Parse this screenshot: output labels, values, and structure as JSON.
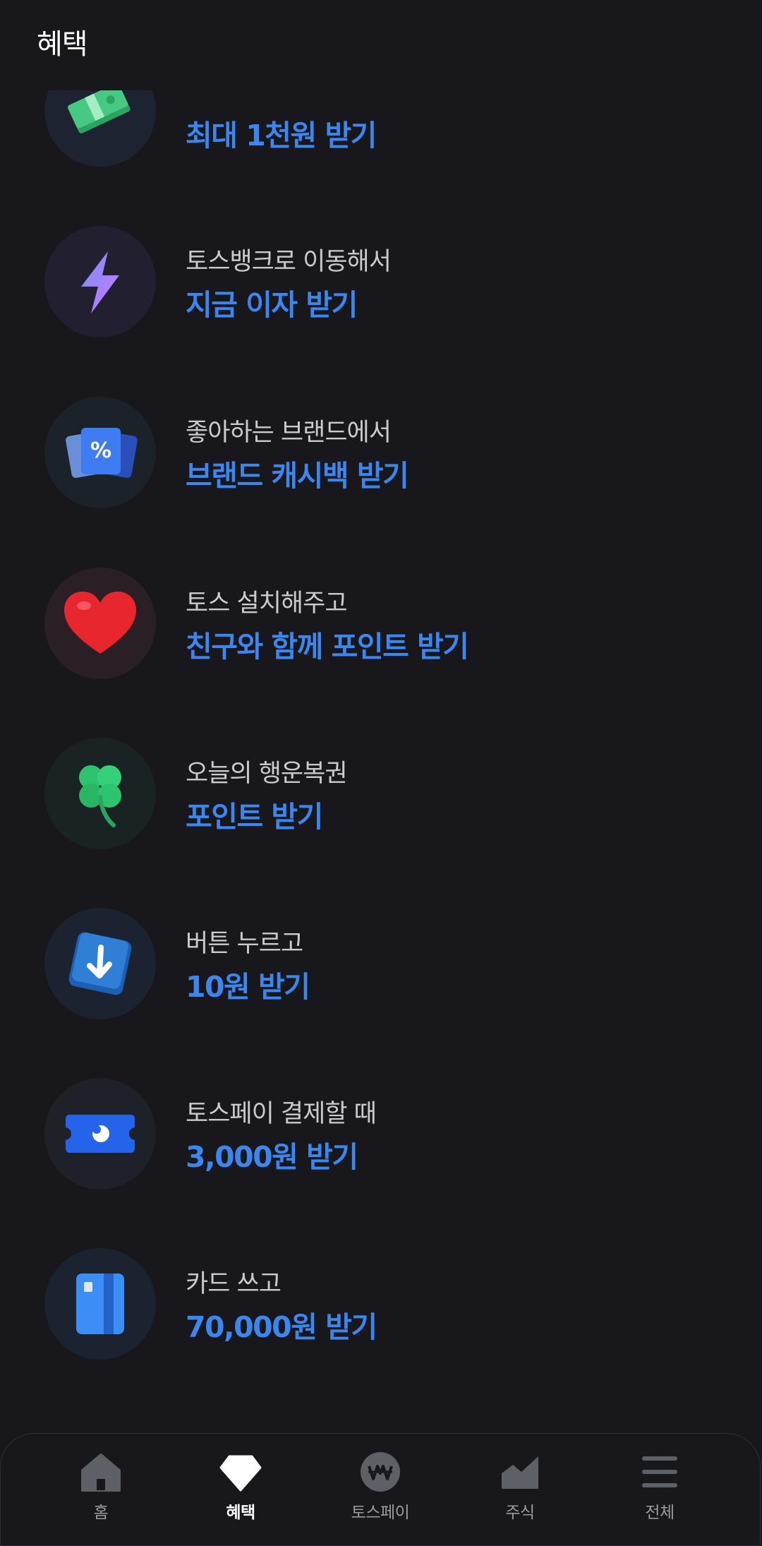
{
  "header": {
    "title": "혜택"
  },
  "benefits": [
    {
      "sub": "",
      "main": "최대 1천원 받기",
      "icon": "money-stack-icon"
    },
    {
      "sub": "토스뱅크로 이동해서",
      "main": "지금 이자 받기",
      "icon": "lightning-icon"
    },
    {
      "sub": "좋아하는 브랜드에서",
      "main": "브랜드 캐시백 받기",
      "icon": "percent-card-icon"
    },
    {
      "sub": "토스 설치해주고",
      "main": "친구와 함께 포인트 받기",
      "icon": "heart-icon"
    },
    {
      "sub": "오늘의 행운복권",
      "main": "포인트 받기",
      "icon": "clover-icon"
    },
    {
      "sub": "버튼 누르고",
      "main": "10원 받기",
      "icon": "down-arrow-button-icon"
    },
    {
      "sub": "토스페이 결제할 때",
      "main": "3,000원 받기",
      "icon": "ticket-icon"
    },
    {
      "sub": "카드 쓰고",
      "main": "70,000원 받기",
      "icon": "card-icon"
    }
  ],
  "tabbar": {
    "tabs": [
      {
        "label": "홈",
        "icon": "home-icon",
        "active": false
      },
      {
        "label": "혜택",
        "icon": "diamond-icon",
        "active": true
      },
      {
        "label": "토스페이",
        "icon": "won-coin-icon",
        "active": false
      },
      {
        "label": "주식",
        "icon": "chart-icon",
        "active": false
      },
      {
        "label": "전체",
        "icon": "menu-icon",
        "active": false
      }
    ]
  },
  "colors": {
    "background": "#17171c",
    "accent": "#3b87f0",
    "subtext": "#c9cbd1"
  }
}
